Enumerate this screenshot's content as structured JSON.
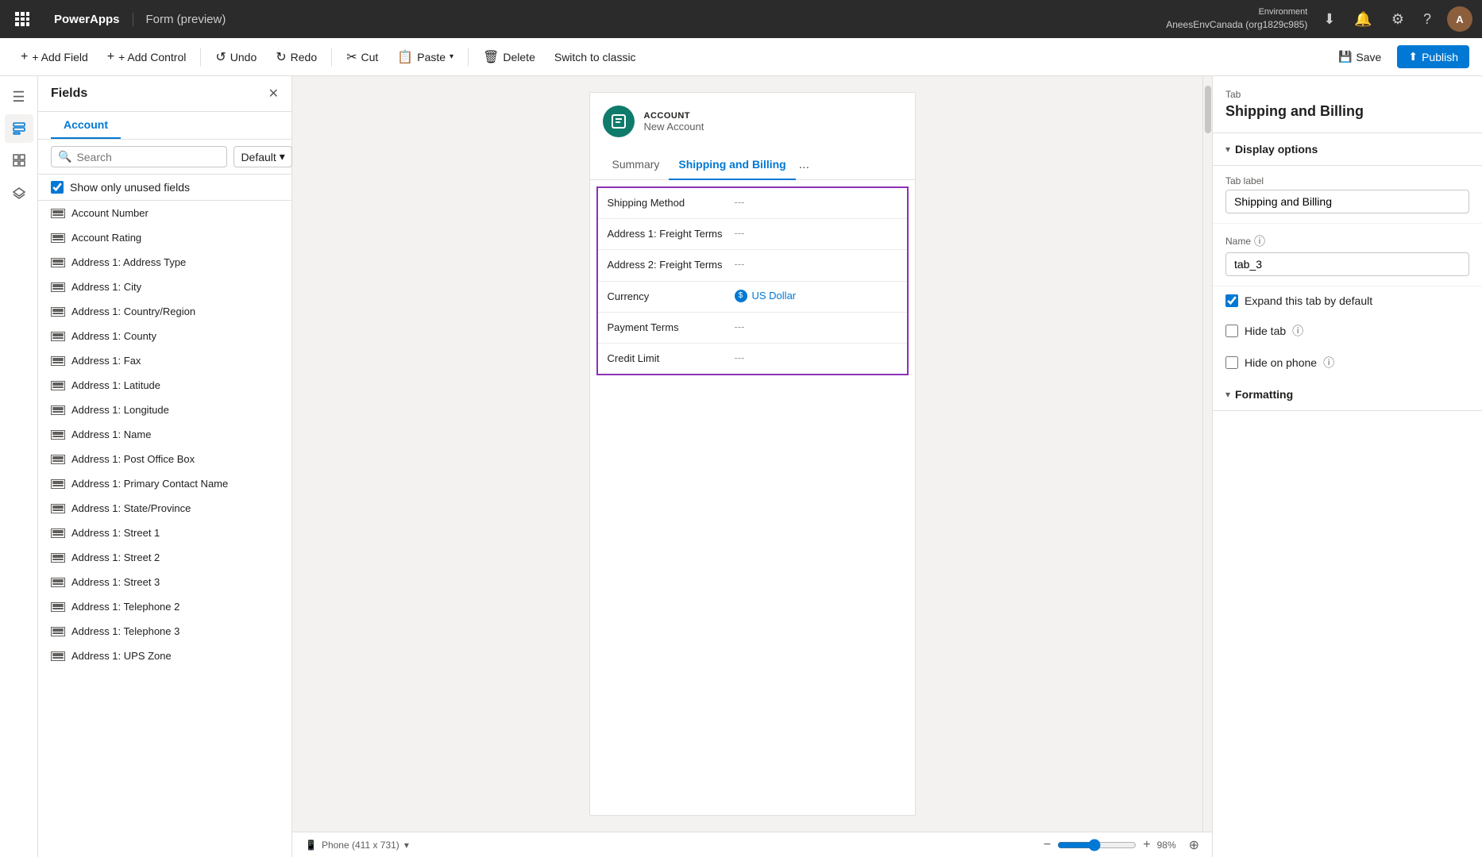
{
  "topnav": {
    "app_name": "PowerApps",
    "page_title": "Form (preview)",
    "env_label": "Environment",
    "env_name": "AneesEnvCanada (org1829c985)",
    "avatar_initials": "A"
  },
  "toolbar": {
    "add_field": "+ Add Field",
    "add_control": "+ Add Control",
    "undo": "Undo",
    "redo": "Redo",
    "cut": "Cut",
    "paste": "Paste",
    "delete": "Delete",
    "switch_classic": "Switch to classic",
    "save": "Save",
    "publish": "Publish"
  },
  "fields_panel": {
    "title": "Fields",
    "tab": "Account",
    "search_placeholder": "Search",
    "dropdown_label": "Default",
    "show_unused_label": "Show only unused fields",
    "items": [
      "Account Number",
      "Account Rating",
      "Address 1: Address Type",
      "Address 1: City",
      "Address 1: Country/Region",
      "Address 1: County",
      "Address 1: Fax",
      "Address 1: Latitude",
      "Address 1: Longitude",
      "Address 1: Name",
      "Address 1: Post Office Box",
      "Address 1: Primary Contact Name",
      "Address 1: State/Province",
      "Address 1: Street 1",
      "Address 1: Street 2",
      "Address 1: Street 3",
      "Address 1: Telephone 2",
      "Address 1: Telephone 3",
      "Address 1: UPS Zone"
    ]
  },
  "form_preview": {
    "entity_type": "ACCOUNT",
    "entity_name": "New Account",
    "tabs": [
      "Summary",
      "Shipping and Billing",
      "..."
    ],
    "active_tab": "Shipping and Billing",
    "fields": [
      {
        "label": "Shipping Method",
        "value": "---"
      },
      {
        "label": "Address 1: Freight Terms",
        "value": "---"
      },
      {
        "label": "Address 2: Freight Terms",
        "value": "---"
      },
      {
        "label": "Currency",
        "value": "US Dollar",
        "type": "currency"
      },
      {
        "label": "Payment Terms",
        "value": "---"
      },
      {
        "label": "Credit Limit",
        "value": "---"
      }
    ]
  },
  "status_bar": {
    "device_icon": "📱",
    "device_label": "Phone (411 x 731)",
    "chevron": "▾",
    "zoom_minus": "−",
    "zoom_plus": "+",
    "zoom_level": "98%",
    "zoom_value": 98
  },
  "right_panel": {
    "breadcrumb": "Tab",
    "title": "Shipping and Billing",
    "display_options_label": "Display options",
    "tab_label_label": "Tab label",
    "tab_label_value": "Shipping and Billing",
    "name_label": "Name",
    "name_value": "tab_3",
    "expand_label": "Expand this tab by default",
    "expand_checked": true,
    "hide_tab_label": "Hide tab",
    "hide_tab_checked": false,
    "hide_on_phone_label": "Hide on phone",
    "hide_on_phone_checked": false,
    "formatting_label": "Formatting"
  }
}
